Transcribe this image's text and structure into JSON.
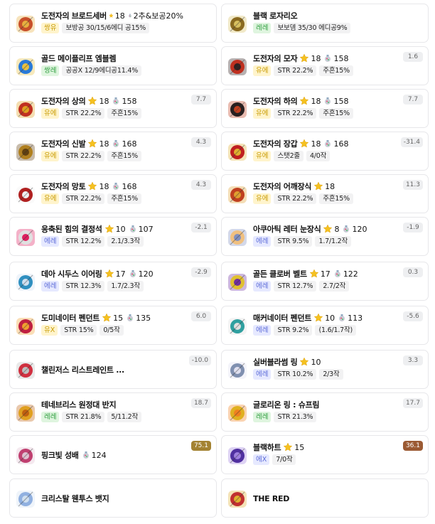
{
  "items": [
    {
      "name": "도전자의 브로드세버",
      "star": "18",
      "sf": "2추&보공20%",
      "grade": "쌍유",
      "tags": [
        "보방공 30/15/6에디 공15%"
      ],
      "score": ""
    },
    {
      "name": "블랙 로자리오",
      "star": "",
      "sf": "",
      "grade": "레레",
      "tags": [
        "보보뎀 35/30 에디공9%"
      ],
      "score": ""
    },
    {
      "name": "골드 메이플리프 엠블렘",
      "star": "",
      "sf": "",
      "grade": "쌍레",
      "tags": [
        "공공X 12/9에디공11.4%"
      ],
      "score": ""
    },
    {
      "name": "도전자의 모자",
      "star": "18",
      "sf": "158",
      "grade": "유에",
      "tags": [
        "STR 22.2%",
        "주흔15%"
      ],
      "score": "1.6"
    },
    {
      "name": "도전자의 상의",
      "star": "18",
      "sf": "158",
      "grade": "유에",
      "tags": [
        "STR 22.2%",
        "주흔15%"
      ],
      "score": "7.7"
    },
    {
      "name": "도전자의 하의",
      "star": "18",
      "sf": "158",
      "grade": "유에",
      "tags": [
        "STR 22.2%",
        "주흔15%"
      ],
      "score": "7.7"
    },
    {
      "name": "도전자의 신발",
      "star": "18",
      "sf": "168",
      "grade": "유에",
      "tags": [
        "STR 22.2%",
        "주흔15%"
      ],
      "score": "4.3"
    },
    {
      "name": "도전자의 장갑",
      "star": "18",
      "sf": "168",
      "grade": "유에",
      "tags": [
        "스탯2줄",
        "4/0작"
      ],
      "score": "-31.4"
    },
    {
      "name": "도전자의 망토",
      "star": "18",
      "sf": "168",
      "grade": "유에",
      "tags": [
        "STR 22.2%",
        "주흔15%"
      ],
      "score": "4.3"
    },
    {
      "name": "도전자의 어깨장식",
      "star": "18",
      "sf": "",
      "grade": "유에",
      "tags": [
        "STR 22.2%",
        "주흔15%"
      ],
      "score": "11.3"
    },
    {
      "name": "응축된 힘의 결정석",
      "star": "10",
      "sf": "107",
      "grade": "에레",
      "tags": [
        "STR 12.2%",
        "2.1/3.3작"
      ],
      "score": "-2.1"
    },
    {
      "name": "아쿠아틱 레터 눈장식",
      "star": "8",
      "sf": "120",
      "grade": "에레",
      "tags": [
        "STR 9.5%",
        "1.7/1.2작"
      ],
      "score": "-1.9"
    },
    {
      "name": "데아 시두스 이어링",
      "star": "17",
      "sf": "120",
      "grade": "에레",
      "tags": [
        "STR 12.3%",
        "1.7/2.3작"
      ],
      "score": "-2.9"
    },
    {
      "name": "골든 클로버 벨트",
      "star": "17",
      "sf": "122",
      "grade": "에레",
      "tags": [
        "STR 12.7%",
        "2.7/2작"
      ],
      "score": "0.3"
    },
    {
      "name": "도미네이터 펜던트",
      "star": "15",
      "sf": "135",
      "grade": "유X",
      "tags": [
        "STR 15%",
        "0/5작"
      ],
      "score": "6.0"
    },
    {
      "name": "매커네이터 펜던트",
      "star": "10",
      "sf": "113",
      "grade": "에레",
      "tags": [
        "STR 9.2%",
        "(1.6/1.7작)"
      ],
      "score": "-5.6"
    },
    {
      "name": "챌린저스 리스트레인트 ...",
      "star": "",
      "sf": "",
      "grade": "",
      "tags": [],
      "score": "-10.0"
    },
    {
      "name": "실버블라썸 링",
      "star": "10",
      "sf": "",
      "grade": "에레",
      "tags": [
        "STR 10.2%",
        "2/3작"
      ],
      "score": "3.3"
    },
    {
      "name": "테네브리스 원정대 반지",
      "star": "",
      "sf": "",
      "grade": "레레",
      "tags": [
        "STR 21.8%",
        "5/11.2작"
      ],
      "score": "18.7"
    },
    {
      "name": "글로리온 링 : 슈프림",
      "star": "",
      "sf": "",
      "grade": "레레",
      "tags": [
        "STR 21.3%"
      ],
      "score": "17.7"
    },
    {
      "name": "핑크빛 성배",
      "star": "",
      "sf": "124",
      "grade": "",
      "tags": [],
      "score": "75.1"
    },
    {
      "name": "블랙하트",
      "star": "15",
      "sf": "",
      "grade": "에X",
      "tags": [
        "7/0작"
      ],
      "score": "36.1"
    },
    {
      "name": "크리스탈 웬투스 뱃지",
      "star": "",
      "sf": "",
      "grade": "",
      "tags": [],
      "score": ""
    },
    {
      "name": "THE RED",
      "star": "",
      "sf": "",
      "grade": "",
      "tags": [],
      "score": ""
    }
  ]
}
